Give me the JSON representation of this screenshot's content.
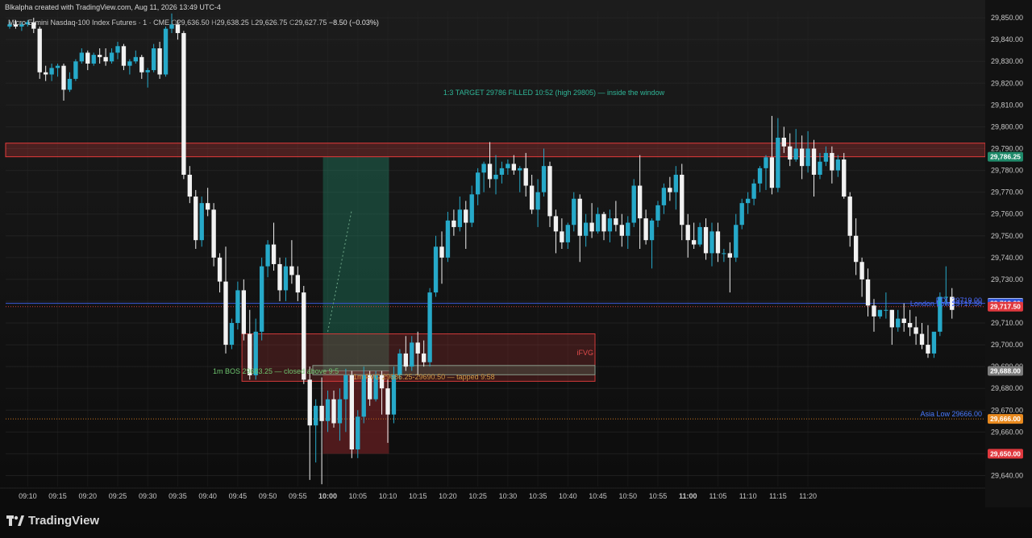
{
  "header": {
    "credit": "Blkalpha created with TradingView.com, Aug 11, 2026 13:49 UTC-4",
    "symbol": "Micro E-mini Nasdaq-100 Index Futures · 1 · CME",
    "o_label": "O",
    "o": "29,636.50",
    "h_label": "H",
    "h": "29,638.25",
    "l_label": "L",
    "l": "29,626.75",
    "c_label": "C",
    "c": "29,627.75",
    "change": "−8.50 (−0.03%)"
  },
  "branding": {
    "text": "TradingView",
    "icon": "tradingview-logo-icon"
  },
  "colors": {
    "bull": "#26a9c9",
    "bear": "#f2f2f2",
    "grid": "#2a2a2a",
    "axis_text": "#c9c9c9",
    "resistance_zone": "#e53b3b",
    "fvg_zone": "#d23a3a",
    "target_zone": "#1f8a6a",
    "stop_zone": "#6b1f22",
    "blue_line": "#3b5bdb",
    "orange_line": "#c9731f"
  },
  "annotations": {
    "target_note": "1:3 TARGET 29786 FILLED 10:52 (high 29805) — inside the window",
    "ifvg": "iFVG",
    "bos": "1m BOS 29683.25 — closed above 9:5",
    "fvg": "1m FVG 29686.25-29690.50 — tapped 9:58",
    "pdl": "PDL 29719.00",
    "london_low": "London Low 29717.50",
    "asia_low": "Asia Low 29666.00"
  },
  "chart_data": {
    "type": "candlestick",
    "interval": "1 minute",
    "ylim": [
      29635,
      29853
    ],
    "y_ticks": [
      29640,
      29650,
      29660,
      29670,
      29680,
      29690,
      29700,
      29710,
      29720,
      29730,
      29740,
      29750,
      29760,
      29770,
      29780,
      29790,
      29800,
      29810,
      29820,
      29830,
      29840,
      29850
    ],
    "x_start": "09:07",
    "x_ticks": [
      "09:10",
      "09:15",
      "09:20",
      "09:25",
      "09:30",
      "09:35",
      "09:40",
      "09:45",
      "09:50",
      "09:55",
      "10:00",
      "10:05",
      "10:10",
      "10:15",
      "10:20",
      "10:25",
      "10:30",
      "10:35",
      "10:40",
      "10:45",
      "10:50",
      "10:55",
      "11:00",
      "11:05",
      "11:10",
      "11:15",
      "11:20"
    ],
    "bold_ticks": [
      "10:00",
      "11:00"
    ],
    "ohlc": [
      [
        29846,
        29848,
        29845,
        29847
      ],
      [
        29847,
        29849,
        29845,
        29846
      ],
      [
        29846,
        29848,
        29844,
        29847
      ],
      [
        29847,
        29849,
        29846,
        29848
      ],
      [
        29848,
        29850,
        29843,
        29845
      ],
      [
        29845,
        29846,
        29822,
        29825
      ],
      [
        29825,
        29828,
        29821,
        29824
      ],
      [
        29824,
        29829,
        29821,
        29827
      ],
      [
        29827,
        29829,
        29823,
        29828
      ],
      [
        29828,
        29829,
        29812,
        29817
      ],
      [
        29817,
        29825,
        29816,
        29822
      ],
      [
        29822,
        29831,
        29821,
        29830
      ],
      [
        29830,
        29836,
        29829,
        29834
      ],
      [
        29834,
        29835,
        29826,
        29829
      ],
      [
        29829,
        29834,
        29828,
        29833
      ],
      [
        29833,
        29836,
        29829,
        29832
      ],
      [
        29832,
        29836,
        29828,
        29830
      ],
      [
        29830,
        29836,
        29829,
        29834
      ],
      [
        29834,
        29839,
        29831,
        29837
      ],
      [
        29837,
        29838,
        29826,
        29828
      ],
      [
        29828,
        29831,
        29824,
        29830
      ],
      [
        29830,
        29835,
        29829,
        29832
      ],
      [
        29832,
        29833,
        29822,
        29825
      ],
      [
        29825,
        29827,
        29818,
        29826
      ],
      [
        29826,
        29838,
        29825,
        29836
      ],
      [
        29836,
        29839,
        29822,
        29824
      ],
      [
        29824,
        29846,
        29823,
        29845
      ],
      [
        29845,
        29852,
        29843,
        29847
      ],
      [
        29847,
        29849,
        29840,
        29843
      ],
      [
        29843,
        29844,
        29776,
        29778
      ],
      [
        29778,
        29782,
        29765,
        29768
      ],
      [
        29768,
        29771,
        29744,
        29748
      ],
      [
        29748,
        29768,
        29745,
        29765
      ],
      [
        29765,
        29772,
        29759,
        29762
      ],
      [
        29762,
        29765,
        29736,
        29740
      ],
      [
        29740,
        29742,
        29724,
        29729
      ],
      [
        29729,
        29745,
        29696,
        29700
      ],
      [
        29700,
        29712,
        29698,
        29710
      ],
      [
        29710,
        29729,
        29707,
        29725
      ],
      [
        29725,
        29730,
        29702,
        29705
      ],
      [
        29705,
        29716,
        29684,
        29686
      ],
      [
        29686,
        29712,
        29684,
        29706
      ],
      [
        29706,
        29740,
        29702,
        29736
      ],
      [
        29736,
        29748,
        29731,
        29746
      ],
      [
        29746,
        29756,
        29734,
        29737
      ],
      [
        29737,
        29740,
        29720,
        29725
      ],
      [
        29725,
        29740,
        29720,
        29736
      ],
      [
        29736,
        29748,
        29728,
        29732
      ],
      [
        29732,
        29736,
        29720,
        29724
      ],
      [
        29724,
        29727,
        29682,
        29684
      ],
      [
        29684,
        29690,
        29638,
        29663
      ],
      [
        29663,
        29675,
        29646,
        29672
      ],
      [
        29672,
        29685,
        29636,
        29665
      ],
      [
        29665,
        29679,
        29660,
        29675
      ],
      [
        29675,
        29679,
        29662,
        29664
      ],
      [
        29664,
        29680,
        29656,
        29675
      ],
      [
        29675,
        29689,
        29660,
        29686
      ],
      [
        29686,
        29688,
        29648,
        29652
      ],
      [
        29652,
        29670,
        29648,
        29667
      ],
      [
        29667,
        29690,
        29664,
        29686
      ],
      [
        29686,
        29688,
        29672,
        29675
      ],
      [
        29675,
        29688,
        29674,
        29686
      ],
      [
        29686,
        29688,
        29668,
        29680
      ],
      [
        29680,
        29684,
        29655,
        29668
      ],
      [
        29668,
        29690,
        29664,
        29686
      ],
      [
        29686,
        29698,
        29684,
        29696
      ],
      [
        29696,
        29704,
        29688,
        29690
      ],
      [
        29690,
        29704,
        29688,
        29701
      ],
      [
        29701,
        29706,
        29686,
        29696
      ],
      [
        29696,
        29702,
        29690,
        29692
      ],
      [
        29692,
        29726,
        29690,
        29724
      ],
      [
        29724,
        29750,
        29722,
        29745
      ],
      [
        29745,
        29752,
        29728,
        29740
      ],
      [
        29740,
        29761,
        29738,
        29757
      ],
      [
        29757,
        29762,
        29750,
        29754
      ],
      [
        29754,
        29768,
        29752,
        29762
      ],
      [
        29762,
        29766,
        29744,
        29756
      ],
      [
        29756,
        29773,
        29754,
        29769
      ],
      [
        29769,
        29781,
        29764,
        29779
      ],
      [
        29779,
        29784,
        29770,
        29783
      ],
      [
        29783,
        29793,
        29772,
        29776
      ],
      [
        29776,
        29787,
        29769,
        29778
      ],
      [
        29778,
        29784,
        29774,
        29781
      ],
      [
        29781,
        29785,
        29778,
        29783
      ],
      [
        29783,
        29787,
        29778,
        29780
      ],
      [
        29780,
        29782,
        29770,
        29781
      ],
      [
        29781,
        29788,
        29768,
        29773
      ],
      [
        29773,
        29778,
        29760,
        29762
      ],
      [
        29762,
        29776,
        29754,
        29770
      ],
      [
        29770,
        29790,
        29768,
        29782
      ],
      [
        29782,
        29784,
        29754,
        29759
      ],
      [
        29759,
        29762,
        29742,
        29752
      ],
      [
        29752,
        29758,
        29744,
        29747
      ],
      [
        29747,
        29756,
        29744,
        29755
      ],
      [
        29755,
        29770,
        29752,
        29767
      ],
      [
        29767,
        29769,
        29738,
        29750
      ],
      [
        29750,
        29760,
        29745,
        29756
      ],
      [
        29756,
        29765,
        29749,
        29752
      ],
      [
        29752,
        29763,
        29751,
        29760
      ],
      [
        29760,
        29761,
        29748,
        29752
      ],
      [
        29752,
        29762,
        29747,
        29758
      ],
      [
        29758,
        29766,
        29752,
        29755
      ],
      [
        29755,
        29760,
        29745,
        29750
      ],
      [
        29750,
        29759,
        29744,
        29756
      ],
      [
        29756,
        29776,
        29754,
        29773
      ],
      [
        29773,
        29787,
        29744,
        29758
      ],
      [
        29758,
        29762,
        29746,
        29748
      ],
      [
        29748,
        29758,
        29735,
        29757
      ],
      [
        29757,
        29766,
        29754,
        29764
      ],
      [
        29764,
        29774,
        29760,
        29772
      ],
      [
        29772,
        29777,
        29766,
        29770
      ],
      [
        29770,
        29782,
        29762,
        29778
      ],
      [
        29778,
        29783,
        29748,
        29755
      ],
      [
        29755,
        29760,
        29740,
        29748
      ],
      [
        29748,
        29756,
        29744,
        29746
      ],
      [
        29746,
        29756,
        29745,
        29754
      ],
      [
        29754,
        29758,
        29739,
        29742
      ],
      [
        29742,
        29756,
        29736,
        29752
      ],
      [
        29752,
        29756,
        29738,
        29742
      ],
      [
        29742,
        29744,
        29738,
        29742
      ],
      [
        29742,
        29747,
        29724,
        29740
      ],
      [
        29740,
        29760,
        29738,
        29755
      ],
      [
        29755,
        29767,
        29753,
        29765
      ],
      [
        29765,
        29770,
        29760,
        29767
      ],
      [
        29767,
        29776,
        29764,
        29774
      ],
      [
        29774,
        29782,
        29770,
        29781
      ],
      [
        29781,
        29787,
        29771,
        29786
      ],
      [
        29786,
        29805,
        29769,
        29772
      ],
      [
        29772,
        29804,
        29770,
        29795
      ],
      [
        29795,
        29800,
        29788,
        29791
      ],
      [
        29791,
        29797,
        29782,
        29785
      ],
      [
        29785,
        29799,
        29784,
        29790
      ],
      [
        29790,
        29796,
        29776,
        29782
      ],
      [
        29782,
        29798,
        29779,
        29790
      ],
      [
        29790,
        29794,
        29768,
        29778
      ],
      [
        29778,
        29788,
        29776,
        29784
      ],
      [
        29784,
        29791,
        29782,
        29788
      ],
      [
        29788,
        29791,
        29774,
        29780
      ],
      [
        29780,
        29787,
        29777,
        29785
      ],
      [
        29785,
        29788,
        29767,
        29768
      ],
      [
        29768,
        29770,
        29745,
        29750
      ],
      [
        29750,
        29758,
        29732,
        29738
      ],
      [
        29738,
        29740,
        29722,
        29730
      ],
      [
        29730,
        29735,
        29713,
        29718
      ],
      [
        29718,
        29721,
        29706,
        29713
      ],
      [
        29713,
        29716,
        29712,
        29716
      ],
      [
        29716,
        29724,
        29712,
        29716
      ],
      [
        29716,
        29716,
        29700,
        29708
      ],
      [
        29708,
        29716,
        29706,
        29712
      ],
      [
        29712,
        29719,
        29706,
        29710
      ],
      [
        29710,
        29716,
        29704,
        29708
      ],
      [
        29708,
        29713,
        29700,
        29705
      ],
      [
        29705,
        29710,
        29698,
        29700
      ],
      [
        29700,
        29709,
        29694,
        29696
      ],
      [
        29696,
        29705,
        29694,
        29706
      ],
      [
        29706,
        29724,
        29704,
        29722
      ],
      [
        29722,
        29736,
        29718,
        29722
      ],
      [
        29722,
        29726,
        29712,
        29716
      ]
    ],
    "zones": {
      "resistance": [
        29786.25,
        29792.5
      ],
      "ifvg": [
        29683.25,
        29705.0
      ],
      "fvg": [
        29686.25,
        29690.5
      ],
      "position_target": [
        29688.0,
        29786.25
      ],
      "position_stop": [
        29650.0,
        29688.0
      ]
    },
    "levels": {
      "pdl": 29719.0,
      "london_low": 29717.5,
      "asia_low": 29666.0
    },
    "price_labels": [
      {
        "value": "29,786.25",
        "color": "#1f8a6a"
      },
      {
        "value": "29,719.25",
        "color": "#f2f2f2"
      },
      {
        "value": "29,719.00",
        "color": "#2f56d8"
      },
      {
        "value": "29,717.50",
        "color": "#e0383e"
      },
      {
        "value": "29,688.00",
        "color": "#7c7c7c"
      },
      {
        "value": "29,666.00",
        "color": "#e8891e"
      },
      {
        "value": "29,650.00",
        "color": "#e0383e"
      }
    ]
  }
}
